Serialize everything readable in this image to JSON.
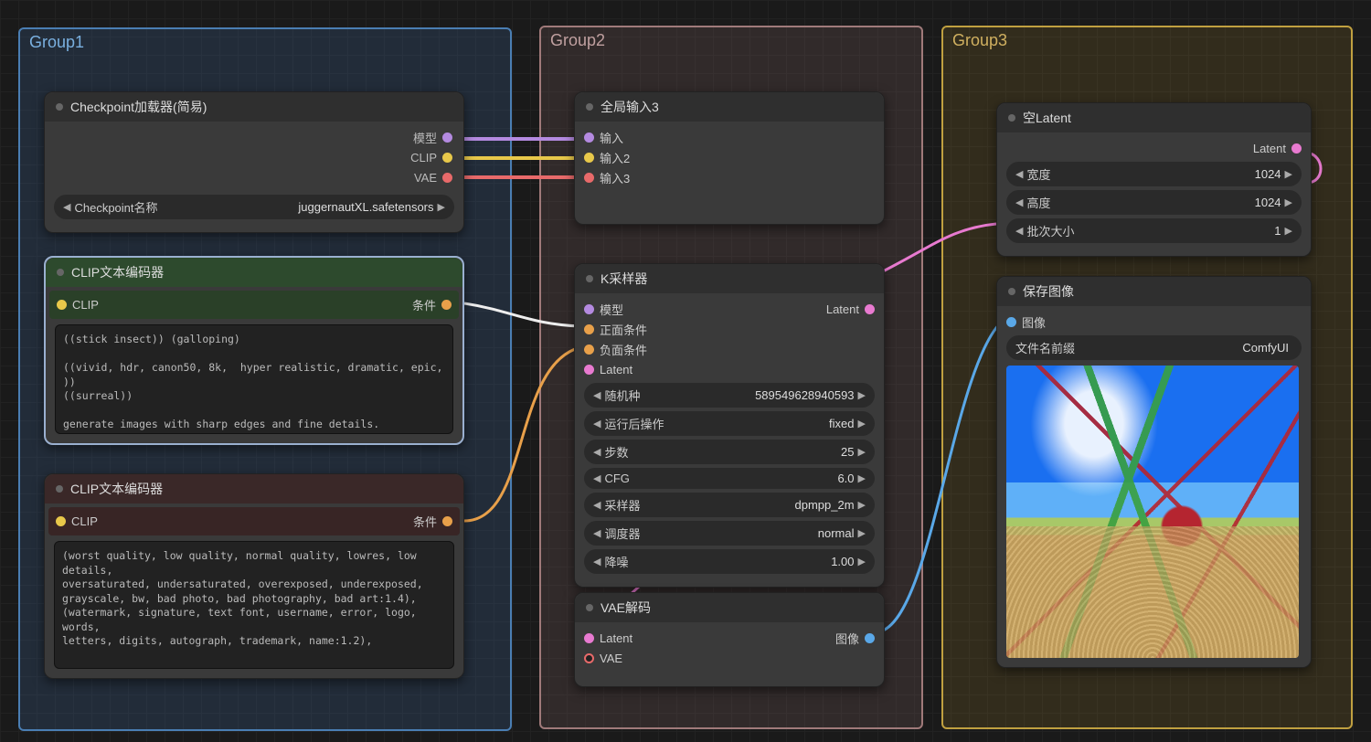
{
  "groups": {
    "g1": "Group1",
    "g2": "Group2",
    "g3": "Group3"
  },
  "nodes": {
    "checkpoint": {
      "title": "Checkpoint加载器(简易)",
      "outputs": {
        "model": "模型",
        "clip": "CLIP",
        "vae": "VAE"
      },
      "widget": {
        "label": "Checkpoint名称",
        "value": "juggernautXL.safetensors"
      }
    },
    "clip_pos": {
      "title": "CLIP文本编码器",
      "input": "CLIP",
      "output": "条件",
      "text": "((stick insect)) (galloping)\n\n((vivid, hdr, canon50, 8k,  hyper realistic, dramatic, epic, ))\n((surreal))\n\ngenerate images with sharp edges and fine details.\nproduce high-resolution images with no blurriness or distortions.\ncreate images with clear and well-defined subjects.\nensure that the output images have crisp lines and distinct\nfeatures."
    },
    "clip_neg": {
      "title": "CLIP文本编码器",
      "input": "CLIP",
      "output": "条件",
      "text": "(worst quality, low quality, normal quality, lowres, low details,\noversaturated, undersaturated, overexposed, underexposed,\ngrayscale, bw, bad photo, bad photography, bad art:1.4),\n(watermark, signature, text font, username, error, logo, words,\nletters, digits, autograph, trademark, name:1.2),"
    },
    "global_inputs": {
      "title": "全局输入3",
      "in1": "输入",
      "in2": "输入2",
      "in3": "输入3"
    },
    "ksampler": {
      "title": "K采样器",
      "inputs": {
        "model": "模型",
        "positive": "正面条件",
        "negative": "负面条件",
        "latent": "Latent"
      },
      "output": "Latent",
      "widgets": {
        "seed": {
          "label": "随机种",
          "value": "589549628940593"
        },
        "after": {
          "label": "运行后操作",
          "value": "fixed"
        },
        "steps": {
          "label": "步数",
          "value": "25"
        },
        "cfg": {
          "label": "CFG",
          "value": "6.0"
        },
        "sampler": {
          "label": "采样器",
          "value": "dpmpp_2m"
        },
        "sched": {
          "label": "调度器",
          "value": "normal"
        },
        "denoise": {
          "label": "降噪",
          "value": "1.00"
        }
      }
    },
    "vae_decode": {
      "title": "VAE解码",
      "in_latent": "Latent",
      "in_vae": "VAE",
      "out_image": "图像"
    },
    "empty_latent": {
      "title": "空Latent",
      "output": "Latent",
      "widgets": {
        "width": {
          "label": "宽度",
          "value": "1024"
        },
        "height": {
          "label": "高度",
          "value": "1024"
        },
        "batch": {
          "label": "批次大小",
          "value": "1"
        }
      }
    },
    "save_image": {
      "title": "保存图像",
      "in_image": "图像",
      "widget": {
        "label": "文件名前缀",
        "value": "ComfyUI"
      }
    }
  }
}
